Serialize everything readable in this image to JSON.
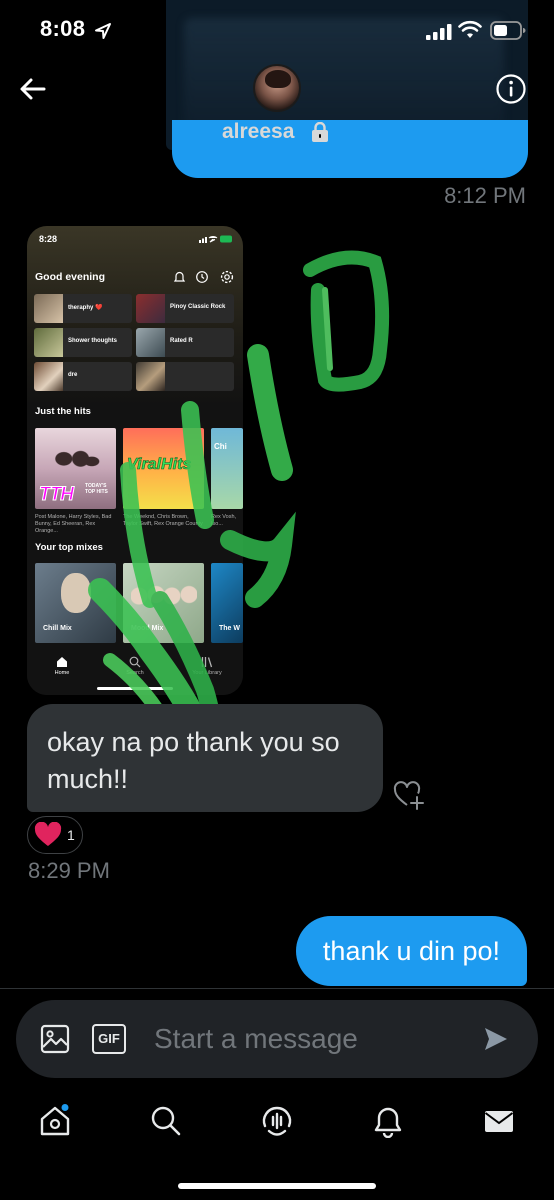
{
  "status_bar": {
    "time": "8:08"
  },
  "header": {
    "contact_name": "alreesa"
  },
  "conversation": {
    "timestamp_1": "8:12 PM",
    "incoming_message": "okay na po thank you so much!!",
    "reaction": {
      "emoji": "heart",
      "count": "1"
    },
    "timestamp_2": "8:29 PM",
    "outgoing_message": "thank u din po!"
  },
  "shared_screenshot": {
    "status_time": "8:28",
    "greeting": "Good evening",
    "tiles": [
      {
        "label": "theraphy ❤️"
      },
      {
        "label": "Pinoy Classic Rock"
      },
      {
        "label": "Shower thoughts"
      },
      {
        "label": "Rated R"
      },
      {
        "label": "dre"
      },
      {
        "label": ""
      }
    ],
    "section_1": "Just the hits",
    "hits_cards": [
      {
        "art_text": "TTH",
        "art_sub": "TODAY'S TOP HITS",
        "caption": "Post Malone, Harry Styles, Bad Bunny, Ed Sheeran, Rex Orange..."
      },
      {
        "art_text": "ViralHits",
        "caption": "The Weeknd, Chris Brown, Taylor Swift, Rex Orange County"
      },
      {
        "art_text": "Chi",
        "caption": "Rex Vosh, Iso... aeseh..."
      }
    ],
    "section_2": "Your top mixes",
    "mix_cards": [
      {
        "label": "Chill Mix"
      },
      {
        "label": "Mood Mix"
      },
      {
        "label": "The W"
      }
    ],
    "nav": [
      {
        "label": "Home"
      },
      {
        "label": "Search"
      },
      {
        "label": "Your Library"
      }
    ]
  },
  "composer": {
    "placeholder": "Start a message",
    "gif_label": "GIF"
  },
  "bottom_nav": [
    {
      "icon": "home-icon"
    },
    {
      "icon": "search-icon"
    },
    {
      "icon": "spaces-icon"
    },
    {
      "icon": "notifications-icon"
    },
    {
      "icon": "messages-icon"
    }
  ],
  "colors": {
    "accent_blue": "#1d9bf0",
    "incoming_bubble": "#2f3336",
    "spotify_green": "#1db954",
    "heart_red": "#f91880"
  }
}
